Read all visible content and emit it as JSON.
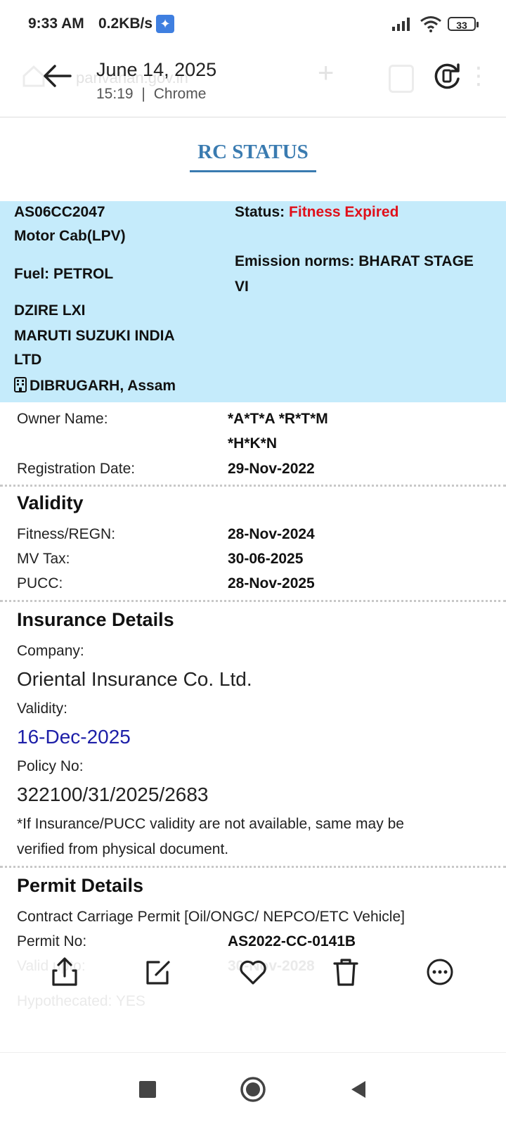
{
  "status_bar": {
    "time": "9:33 AM",
    "net_speed": "0.2KB/s",
    "battery": "33"
  },
  "header": {
    "date": "June 14, 2025",
    "time": "15:19",
    "separator": "|",
    "app": "Chrome",
    "ghost_url": "parivahan.gov.in"
  },
  "title": "RC STATUS",
  "vehicle": {
    "reg_no": "AS06CC2047",
    "class": "Motor Cab(LPV)",
    "fuel": "Fuel: PETROL",
    "model": "DZIRE LXI",
    "maker_line1": "MARUTI SUZUKI INDIA",
    "maker_line2": "LTD",
    "location": "DIBRUGARH, Assam",
    "status_label": "Status:",
    "status_value": "Fitness Expired",
    "emission_line1": "Emission norms: BHARAT STAGE",
    "emission_line2": "VI"
  },
  "owner": {
    "label": "Owner Name:",
    "value_line1": "*A*T*A *R*T*M",
    "value_line2": "*H*K*N"
  },
  "registration": {
    "label": "Registration Date:",
    "value": "29-Nov-2022"
  },
  "validity": {
    "heading": "Validity",
    "rows": [
      {
        "label": "Fitness/REGN:",
        "value": "28-Nov-2024"
      },
      {
        "label": "MV Tax:",
        "value": "30-06-2025"
      },
      {
        "label": "PUCC:",
        "value": "28-Nov-2025"
      }
    ]
  },
  "insurance": {
    "heading": "Insurance Details",
    "company_label": "Company:",
    "company": "Oriental Insurance Co. Ltd.",
    "validity_label": "Validity:",
    "validity": "16-Dec-2025",
    "policy_label": "Policy No:",
    "policy": "322100/31/2025/2683",
    "note_line1": "*If Insurance/PUCC validity are not available, same may be",
    "note_line2": "verified from physical document."
  },
  "permit": {
    "heading": "Permit Details",
    "type": "Contract Carriage Permit [Oil/ONGC/ NEPCO/ETC Vehicle]",
    "no_label": "Permit No:",
    "no_value": "AS2022-CC-0141B",
    "valid_label": "Valid upto:",
    "valid_value": "30-Nov-2028",
    "extra_label": "Hypothecated: YES"
  },
  "actions": [
    "share-icon",
    "edit-icon",
    "heart-icon",
    "trash-icon",
    "more-icon"
  ],
  "colors": {
    "panel": "#c5ebfb",
    "title": "#3a7bb0",
    "status_red": "#e0101a",
    "date_blue": "#1d1fa8"
  }
}
